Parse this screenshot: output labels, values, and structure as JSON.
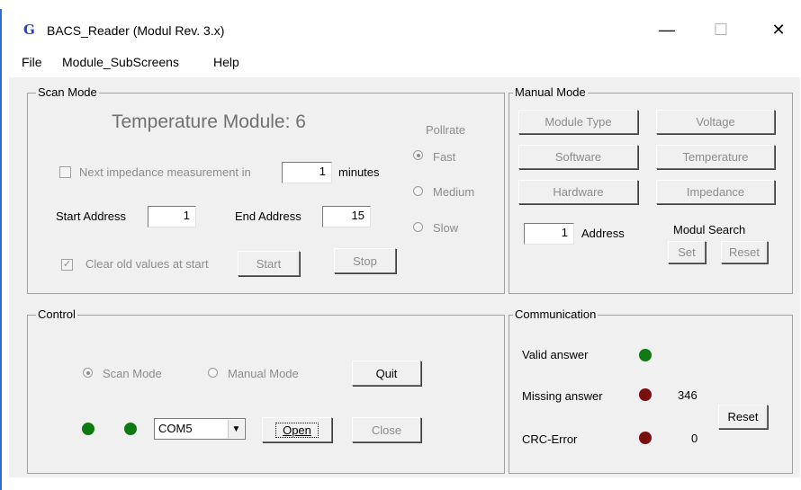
{
  "window": {
    "icon_glyph": "G",
    "title": "BACS_Reader (Modul Rev. 3.x)",
    "minimize_glyph": "—",
    "maximize_glyph": "☐",
    "close_glyph": "✕"
  },
  "menu": {
    "items": [
      "File",
      "Module_SubScreens",
      "Help"
    ]
  },
  "scan_mode": {
    "title": "Scan Mode",
    "heading": "Temperature Module:  6",
    "next_impedance_label": "Next impedance measurement in",
    "next_impedance_value": "1",
    "minutes_label": "minutes",
    "start_address_label": "Start Address",
    "start_address_value": "1",
    "end_address_label": "End Address",
    "end_address_value": "15",
    "clear_old_label": "Clear old values at start",
    "start_button": "Start",
    "stop_button": "Stop",
    "pollrate_label": "Pollrate",
    "pollrate_options": [
      "Fast",
      "Medium",
      "Slow"
    ],
    "pollrate_selected": "Fast"
  },
  "manual_mode": {
    "title": "Manual Mode",
    "buttons": [
      "Module Type",
      "Voltage",
      "Software",
      "Temperature",
      "Hardware",
      "Impedance"
    ],
    "address_value": "1",
    "address_label": "Address",
    "modul_search_label": "Modul Search",
    "set_button": "Set",
    "reset_button": "Reset"
  },
  "control": {
    "title": "Control",
    "scan_mode_radio": "Scan Mode",
    "manual_mode_radio": "Manual Mode",
    "quit_button": "Quit",
    "com_port": "COM5",
    "open_button": "Open",
    "close_button": "Close",
    "colors": {
      "led_green": "#0f7a12"
    }
  },
  "communication": {
    "title": "Communication",
    "valid_label": "Valid answer",
    "missing_label": "Missing answer",
    "missing_count": "346",
    "crc_label": "CRC-Error",
    "crc_count": "0",
    "reset_button": "Reset",
    "colors": {
      "valid": "#0f7a12",
      "error": "#7a0f0f"
    }
  }
}
